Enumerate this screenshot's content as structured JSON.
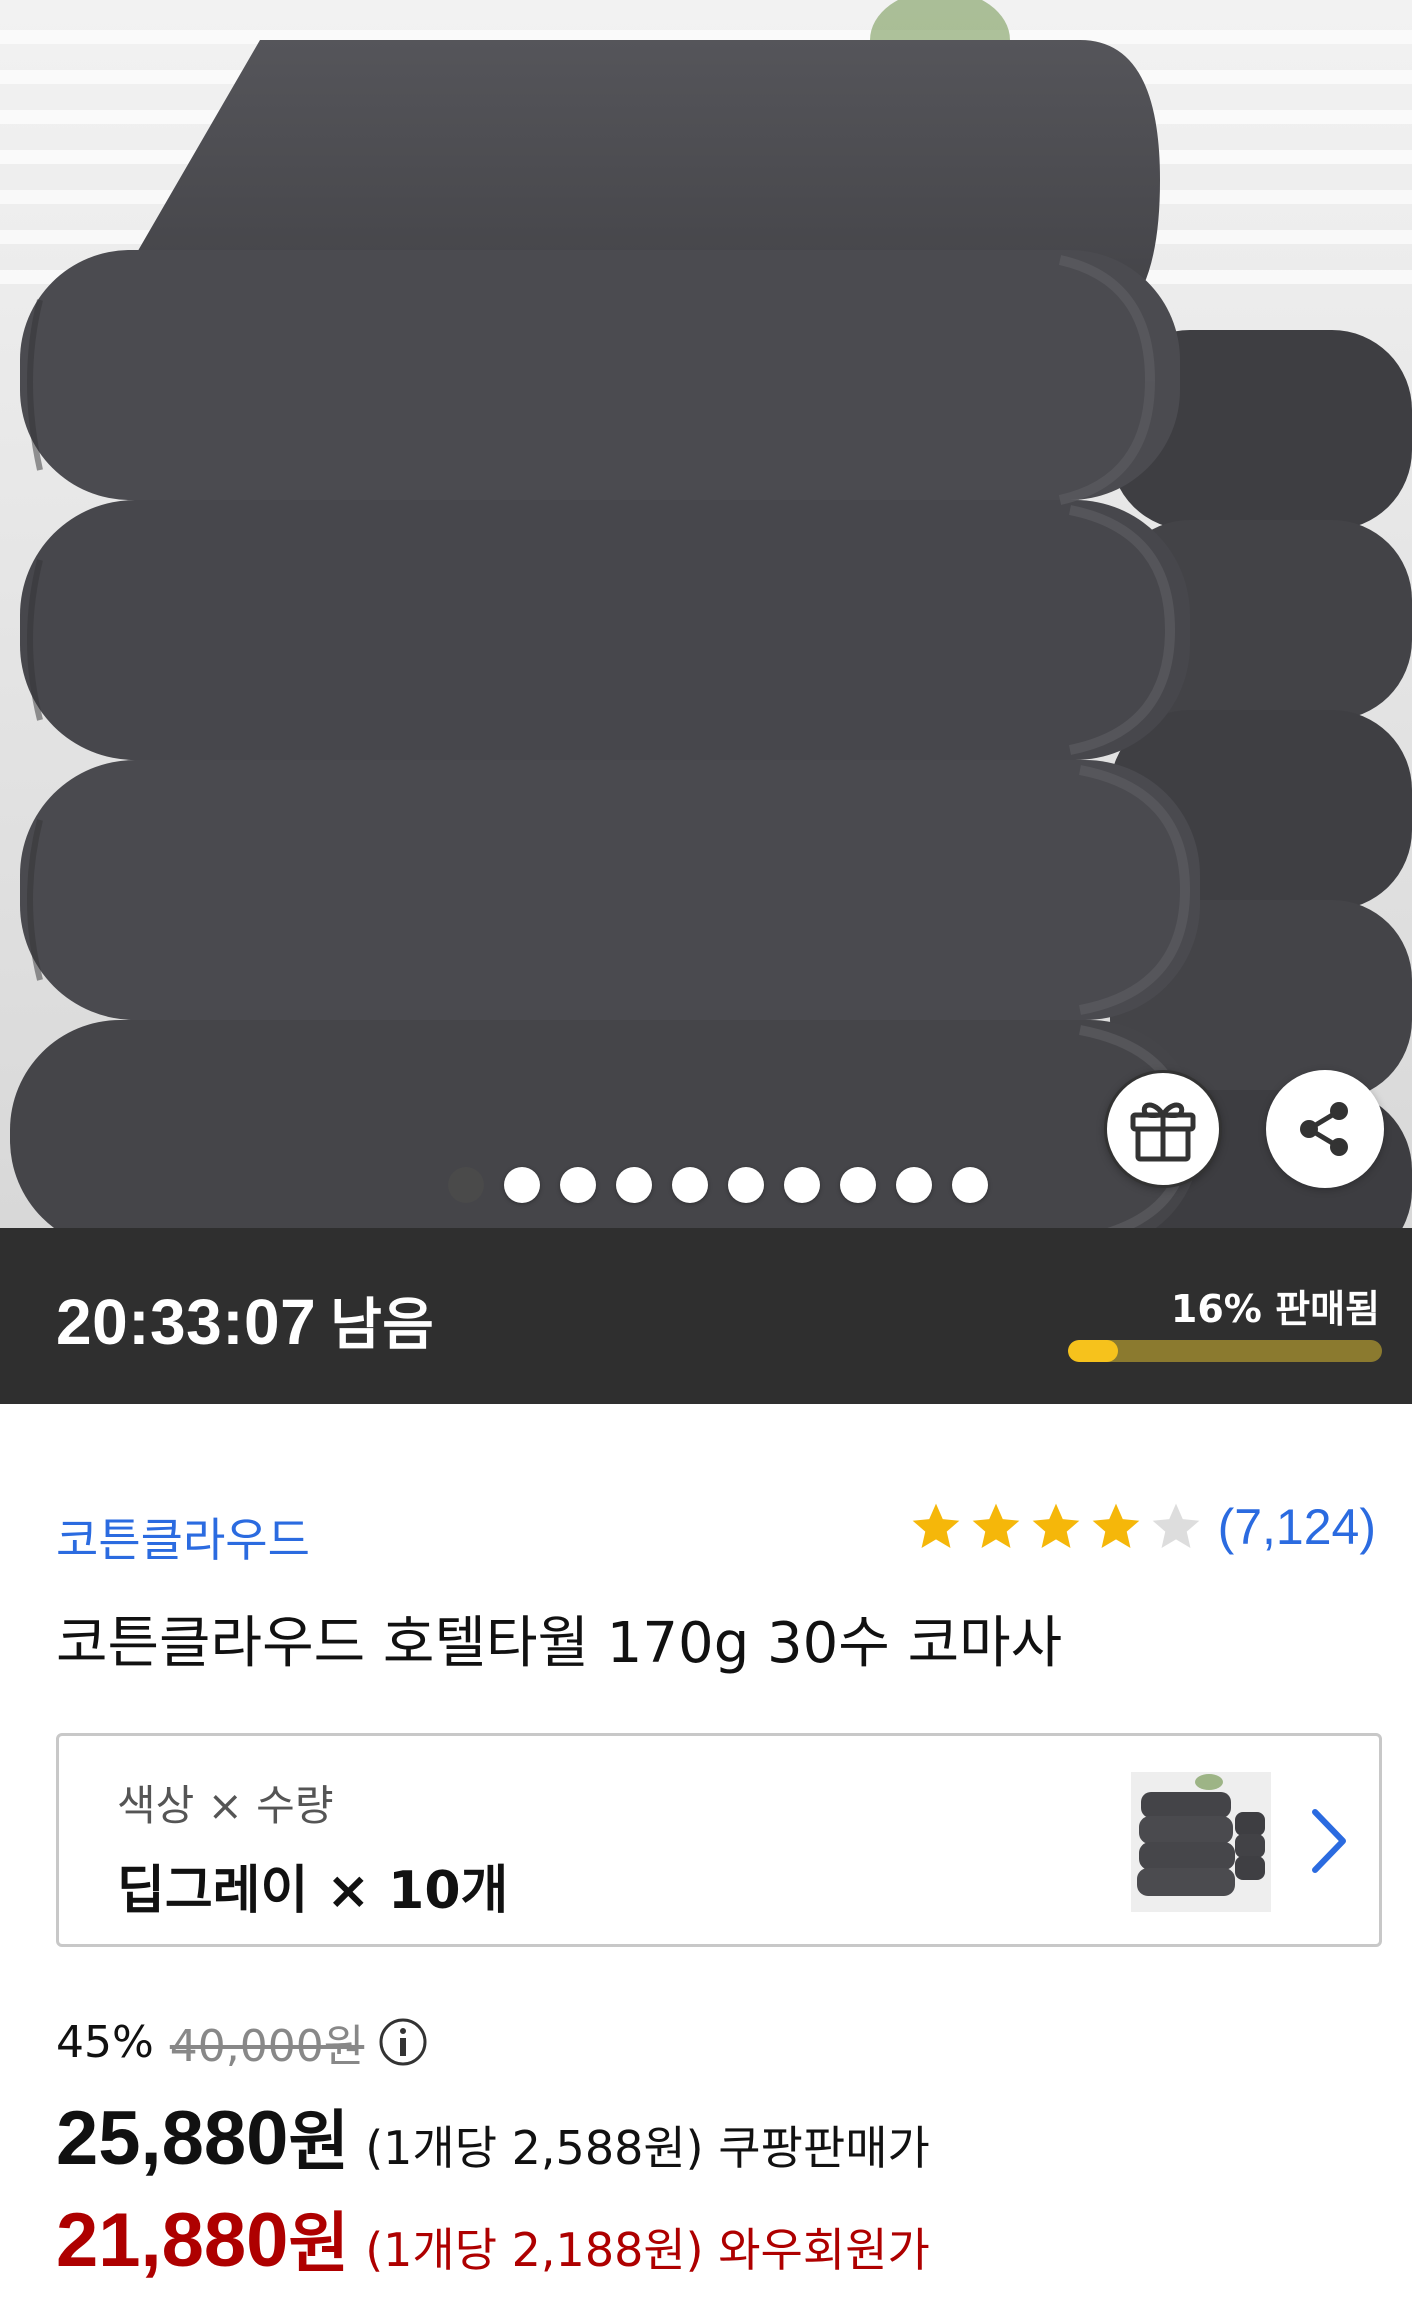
{
  "hero": {
    "image_alt": "dark gray stacked hotel towels",
    "gift_icon": "gift-icon",
    "share_icon": "share-icon",
    "carousel": {
      "total": 10,
      "active_index": 0
    }
  },
  "deal": {
    "time_left": "20:33:07",
    "time_left_suffix": "남음",
    "sold_label": "16% 판매됨",
    "sold_fraction": 0.16,
    "colors": {
      "bar_bg": "#2f2f2f",
      "progress_fill": "#f6c21c",
      "progress_track": "#8b7a2f"
    }
  },
  "product": {
    "brand": "코튼클라우드",
    "rating": 4,
    "rating_max": 5,
    "review_count": "(7,124)",
    "title": "코튼클라우드 호텔타월 170g 30수 코마사",
    "colors": {
      "brand_link": "#2b6be0",
      "star_on": "#f5b70a",
      "star_off": "#dddddd"
    }
  },
  "option": {
    "label": "색상 × 수량",
    "value": "딥그레이 × 10개",
    "chevron_icon": "chevron-right-icon"
  },
  "price": {
    "discount_rate": "45%",
    "original_price": "40,000원",
    "info_icon": "info-icon",
    "coupang": {
      "amount": "25,880",
      "won": "원",
      "unit_note": "(1개당 2,588원) 쿠팡판매가"
    },
    "wow": {
      "amount": "21,880",
      "won": "원",
      "unit_note": "(1개당 2,188원) 와우회원가",
      "color": "#ae0000"
    }
  }
}
